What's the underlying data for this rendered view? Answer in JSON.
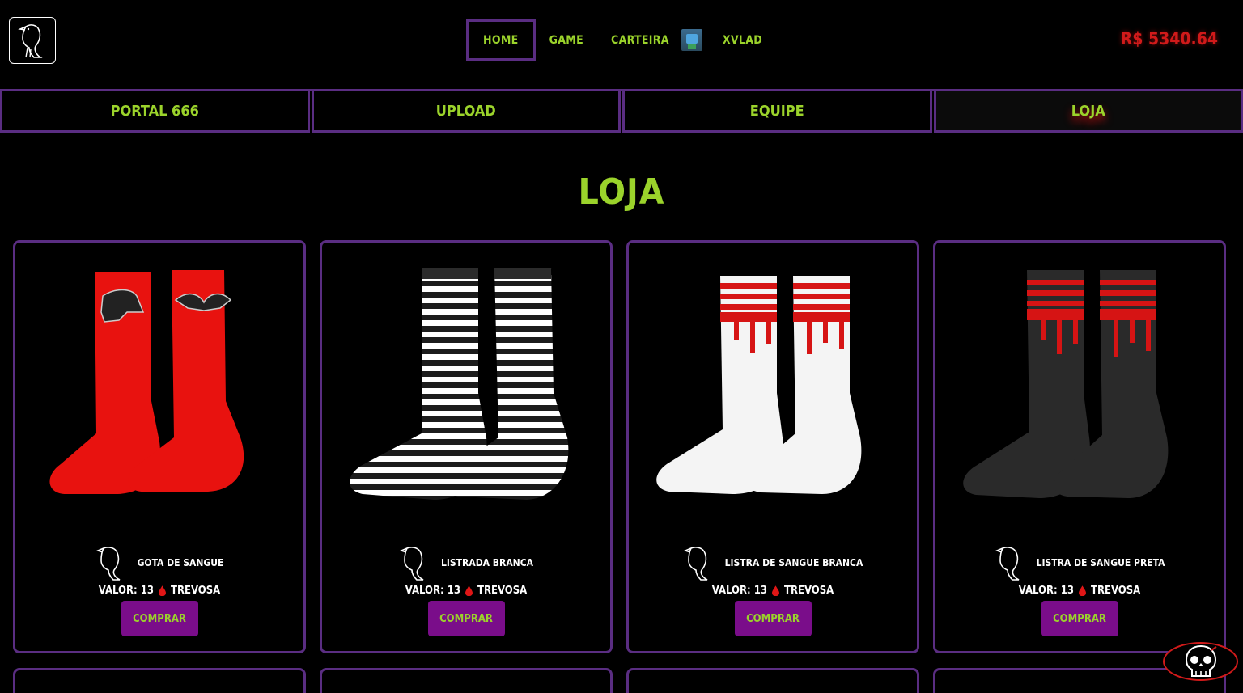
{
  "header": {
    "nav": [
      {
        "label": "Home",
        "active": true
      },
      {
        "label": "Game",
        "active": false
      },
      {
        "label": "Carteira",
        "active": false,
        "avatar": true
      },
      {
        "label": "Xvlad",
        "active": false
      }
    ],
    "balance": "R$ 5340.64"
  },
  "tabs": [
    {
      "label": "Portal 666",
      "active": false
    },
    {
      "label": "Upload",
      "active": false
    },
    {
      "label": "Equipe",
      "active": false
    },
    {
      "label": "Loja",
      "active": true
    }
  ],
  "page_title": "Loja",
  "products": [
    {
      "name": "Gota de Sangue",
      "price_label": "Valor: 13",
      "currency": "Trevosa",
      "button": "Comprar",
      "style": "red"
    },
    {
      "name": "Listrada Branca",
      "price_label": "Valor: 13",
      "currency": "Trevosa",
      "button": "Comprar",
      "style": "striped"
    },
    {
      "name": "Listra de Sangue Branca",
      "price_label": "Valor: 13",
      "currency": "Trevosa",
      "button": "Comprar",
      "style": "white-blood"
    },
    {
      "name": "Listra de Sangue Preta",
      "price_label": "Valor: 13",
      "currency": "Trevosa",
      "button": "Comprar",
      "style": "black-blood"
    }
  ],
  "colors": {
    "accent": "#9bd32b",
    "border": "#5a2d82",
    "button": "#7a0d8a",
    "balance": "#d11a1a"
  },
  "icons": {
    "logo": "crow-icon",
    "currency": "blood-drop-icon",
    "floating": "skull-icon"
  }
}
